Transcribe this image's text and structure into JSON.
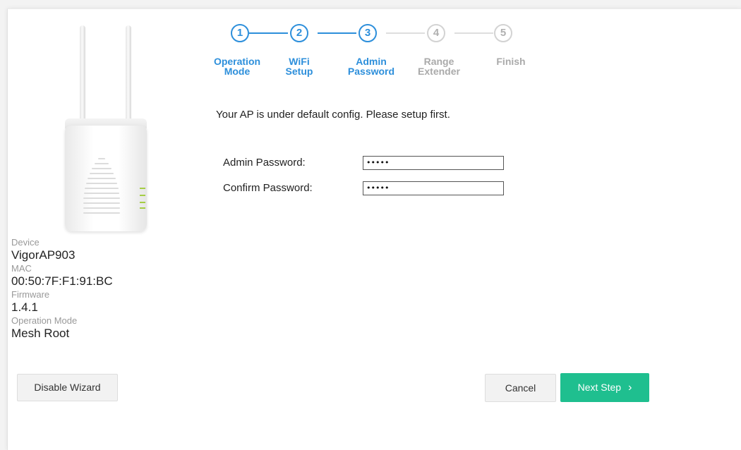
{
  "wizard": {
    "steps": [
      {
        "number": "1",
        "label": "Operation\nMode",
        "state": "active"
      },
      {
        "number": "2",
        "label": "WiFi\nSetup",
        "state": "active"
      },
      {
        "number": "3",
        "label": "Admin\nPassword",
        "state": "active"
      },
      {
        "number": "4",
        "label": "Range\nExtender",
        "state": "inactive"
      },
      {
        "number": "5",
        "label": "Finish",
        "state": "inactive"
      }
    ],
    "current_step": 3,
    "colors": {
      "active": "#2d8fdb",
      "inactive": "#d3d3d3",
      "primary_button": "#1fbf8f"
    }
  },
  "device_info": {
    "device_label": "Device",
    "device_value": "VigorAP903",
    "mac_label": "MAC",
    "mac_value": "00:50:7F:F1:91:BC",
    "firmware_label": "Firmware",
    "firmware_value": "1.4.1",
    "mode_label": "Operation Mode",
    "mode_value": "Mesh Root"
  },
  "form": {
    "intro": "Your AP is under default config. Please setup first.",
    "admin_password_label": "Admin Password:",
    "admin_password_value": "•••••",
    "confirm_password_label": "Confirm Password:",
    "confirm_password_value": "•••••"
  },
  "buttons": {
    "disable_wizard": "Disable Wizard",
    "cancel": "Cancel",
    "next_step": "Next Step",
    "next_icon": "›"
  },
  "icons": {
    "next_icon_name": "chevron-right-icon",
    "device_image_name": "access-point-image"
  }
}
